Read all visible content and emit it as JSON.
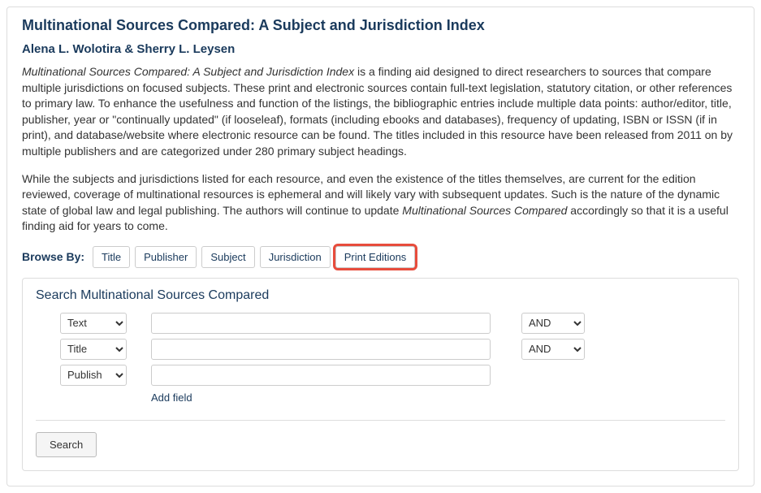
{
  "header": {
    "title": "Multinational Sources Compared: A Subject and Jurisdiction Index",
    "authors": "Alena L. Wolotira & Sherry L. Leysen"
  },
  "description": {
    "ital1": "Multinational Sources Compared: A Subject and Jurisdiction Index",
    "para1_rest": " is a finding aid designed to direct researchers to sources that compare multiple jurisdictions on focused subjects. These print and electronic sources contain full-text legislation, statutory citation, or other references to primary law. To enhance the usefulness and function of the listings, the bibliographic entries include multiple data points: author/editor, title, publisher, year or \"continually updated\" (if looseleaf), formats (including ebooks and databases), frequency of updating, ISBN or ISSN (if in print), and database/website where electronic resource can be found. The titles included in this resource have been released from 2011 on by multiple publishers and are categorized under 280 primary subject headings.",
    "para2_a": "While the subjects and jurisdictions listed for each resource, and even the existence of the titles themselves, are current for the edition reviewed, coverage of multinational resources is ephemeral and will likely vary with subsequent updates. Such is the nature of the dynamic state of global law and legal publishing. The authors will continue to update ",
    "ital2": "Multinational Sources Compared",
    "para2_b": " accordingly so that it is a useful finding aid for years to come."
  },
  "browse": {
    "label": "Browse By:",
    "items": [
      {
        "label": "Title"
      },
      {
        "label": "Publisher"
      },
      {
        "label": "Subject"
      },
      {
        "label": "Jurisdiction"
      },
      {
        "label": "Print Editions"
      }
    ]
  },
  "search": {
    "title": "Search Multinational Sources Compared",
    "rows": [
      {
        "field": "Text",
        "bool": "AND"
      },
      {
        "field": "Title",
        "bool": "AND"
      },
      {
        "field": "Publish"
      }
    ],
    "add_field_label": "Add field",
    "submit_label": "Search"
  }
}
